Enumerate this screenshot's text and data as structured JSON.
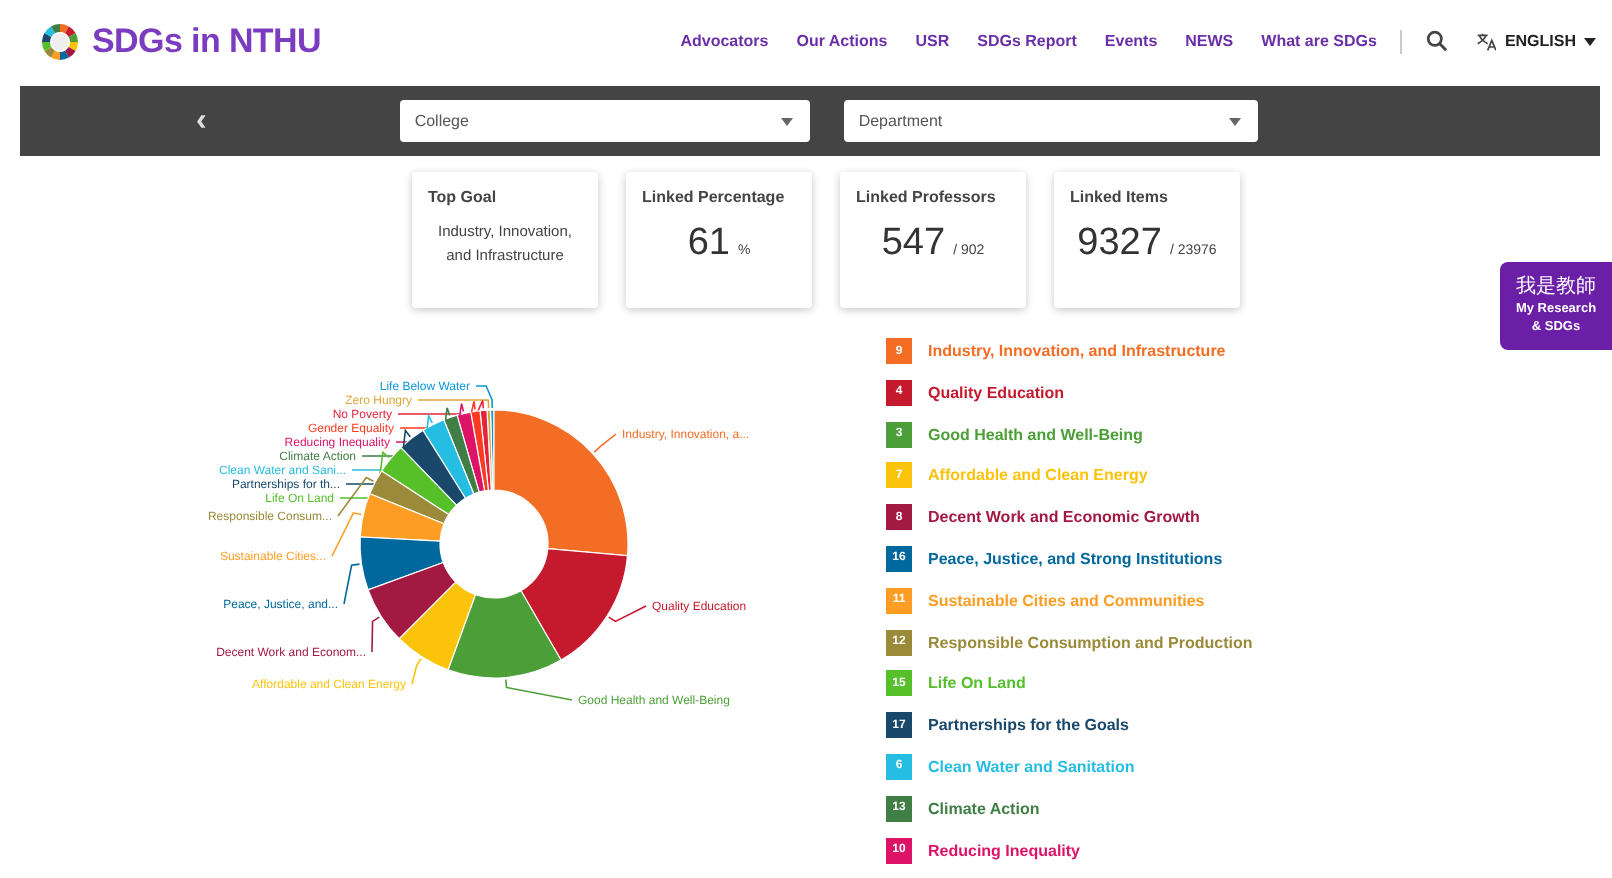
{
  "header": {
    "title": "SDGs in NTHU",
    "nav": [
      "Advocators",
      "Our Actions",
      "USR",
      "SDGs Report",
      "Events",
      "NEWS",
      "What are SDGs"
    ],
    "language": "ENGLISH"
  },
  "filters": {
    "back": "‹",
    "selects": [
      {
        "placeholder": "College"
      },
      {
        "placeholder": "Department"
      }
    ]
  },
  "stats": [
    {
      "kind": "text",
      "label": "Top Goal",
      "value": "Industry, Innovation, and Infrastructure"
    },
    {
      "kind": "number",
      "label": "Linked Percentage",
      "value": "61",
      "unit": "%"
    },
    {
      "kind": "number",
      "label": "Linked Professors",
      "value": "547",
      "unit": "/ 902"
    },
    {
      "kind": "number",
      "label": "Linked Items",
      "value": "9327",
      "unit": "/ 23976"
    }
  ],
  "chart_slices": [
    {
      "label": "Life Below Water",
      "color": "#0a97d9"
    },
    {
      "label": "Zero Hungry",
      "color": "#dda63a"
    },
    {
      "label": "No Poverty",
      "color": "#e5243b"
    },
    {
      "label": "Gender Equality",
      "color": "#ff3a21"
    },
    {
      "label": "Industry, Innovation, a...",
      "color": "#f36d25"
    },
    {
      "label": "Reducing Inequality",
      "color": "#dd1367"
    },
    {
      "label": "Climate Action",
      "color": "#3f7e44"
    },
    {
      "label": "Clean Water and Sani...",
      "color": "#26bde2"
    },
    {
      "label": "Partnerships for th...",
      "color": "#19486a"
    },
    {
      "label": "Life On Land",
      "color": "#56c02b"
    },
    {
      "label": "Responsible Consum...",
      "color": "#9a8a3a"
    },
    {
      "label": "Sustainable Cities...",
      "color": "#fd9d24"
    },
    {
      "label": "Peace, Justice, and...",
      "color": "#00689d"
    },
    {
      "label": "Quality Education",
      "color": "#c5192d"
    },
    {
      "label": "Decent Work and Econom...",
      "color": "#a21942"
    },
    {
      "label": "Affordable and Clean Energy",
      "color": "#fcc30b"
    },
    {
      "label": "Good Health and Well-Being",
      "color": "#4c9f38"
    }
  ],
  "legend": [
    {
      "number": "9",
      "label": "Industry, Innovation, and Infrastructure",
      "color": "#f36d25"
    },
    {
      "number": "4",
      "label": "Quality Education",
      "color": "#c5192d"
    },
    {
      "number": "3",
      "label": "Good Health and Well-Being",
      "color": "#4c9f38"
    },
    {
      "number": "7",
      "label": "Affordable and Clean Energy",
      "color": "#fcc30b"
    },
    {
      "number": "8",
      "label": "Decent Work and Economic Growth",
      "color": "#a21942"
    },
    {
      "number": "16",
      "label": "Peace, Justice, and Strong Institutions",
      "color": "#00689d"
    },
    {
      "number": "11",
      "label": "Sustainable Cities and Communities",
      "color": "#fd9d24"
    },
    {
      "number": "12",
      "label": "Responsible Consumption and Production",
      "color": "#9a8a3a"
    },
    {
      "number": "15",
      "label": "Life On Land",
      "color": "#56c02b"
    },
    {
      "number": "17",
      "label": "Partnerships for the Goals",
      "color": "#19486a"
    },
    {
      "number": "6",
      "label": "Clean Water and Sanitation",
      "color": "#26bde2"
    },
    {
      "number": "13",
      "label": "Climate Action",
      "color": "#3f7e44"
    },
    {
      "number": "10",
      "label": "Reducing Inequality",
      "color": "#dd1367"
    }
  ],
  "side_button": {
    "lines": [
      "我是教師",
      "My Research",
      "& SDGs"
    ]
  }
}
